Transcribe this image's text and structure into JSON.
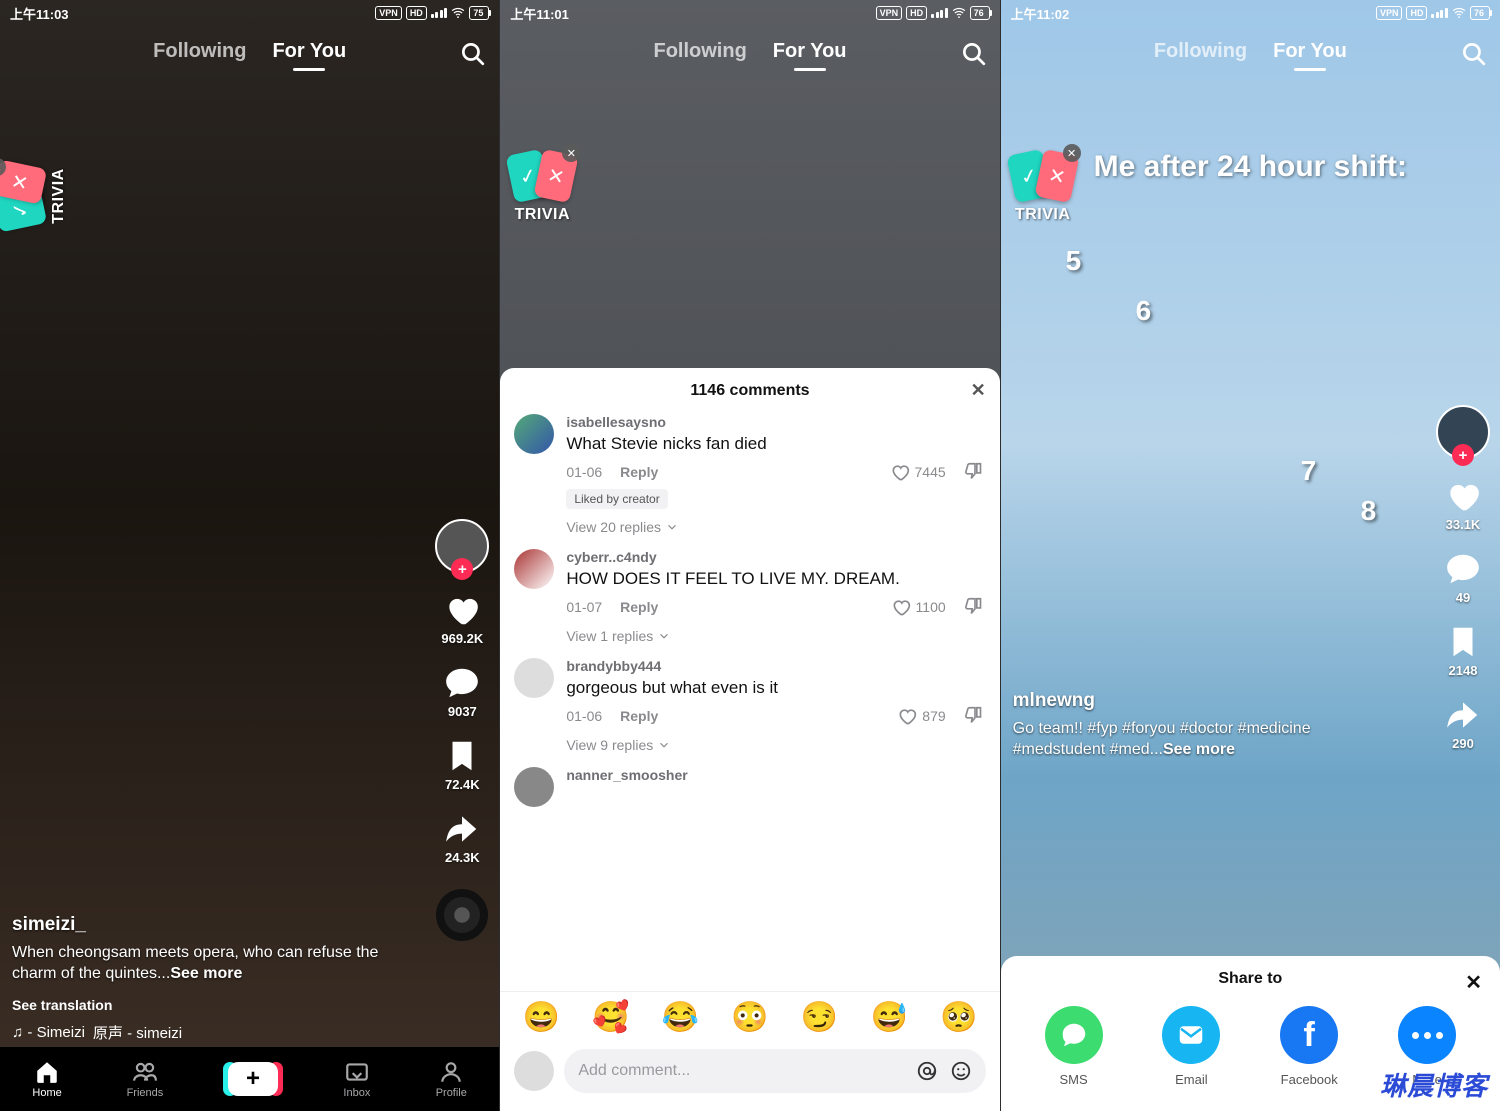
{
  "status": {
    "s1_time": "上午11:03",
    "s1_batt": "75",
    "s2_time": "上午11:01",
    "s2_batt": "76",
    "s3_time": "上午11:02",
    "s3_batt": "76",
    "vpn": "VPN",
    "hd": "HD"
  },
  "nav": {
    "following": "Following",
    "foryou": "For You"
  },
  "trivia": {
    "label": "TRIVIA"
  },
  "screen1": {
    "user": "simeizi_",
    "desc": "When cheongsam meets opera, who can refuse the charm of the quintes...",
    "seemore": "See more",
    "seetrans": "See translation",
    "soundA": "♫ - Simeizi",
    "soundB": "原声 - simeizi",
    "likes": "969.2K",
    "comments": "9037",
    "saves": "72.4K",
    "shares": "24.3K"
  },
  "bottomnav": {
    "home": "Home",
    "friends": "Friends",
    "inbox": "Inbox",
    "profile": "Profile"
  },
  "screen2": {
    "title": "1146 comments",
    "c1": {
      "user": "isabellesaysno",
      "text": "What Stevie nicks fan died",
      "date": "01-06",
      "reply": "Reply",
      "likes": "7445",
      "liked": "Liked by creator",
      "view": "View 20 replies"
    },
    "c2": {
      "user": "cyberr..c4ndy",
      "text": "HOW DOES IT FEEL TO LIVE MY. DREAM.",
      "date": "01-07",
      "reply": "Reply",
      "likes": "1100",
      "view": "View 1 replies"
    },
    "c3": {
      "user": "brandybby444",
      "text": "gorgeous but what even is it",
      "date": "01-06",
      "reply": "Reply",
      "likes": "879",
      "view": "View 9 replies"
    },
    "c4": {
      "user": "nanner_smoosher"
    },
    "emojis": {
      "e1": "😄",
      "e2": "🥰",
      "e3": "😂",
      "e4": "😳",
      "e5": "😏",
      "e6": "😅",
      "e7": "🥺"
    },
    "placeholder": "Add comment..."
  },
  "screen3": {
    "overlay": "Me after 24 hour shift:",
    "n5": "5",
    "n6": "6",
    "n7": "7",
    "n8": "8",
    "user": "mlnewng",
    "desc": "Go team!! #fyp #foryou #doctor #medicine #medstudent #med...",
    "seemore": "See more",
    "likes": "33.1K",
    "comments": "49",
    "saves": "2148",
    "shares": "290",
    "share": {
      "title": "Share to",
      "sms": "SMS",
      "email": "Email",
      "facebook": "Facebook",
      "more": "More"
    }
  },
  "watermark": "琳晨博客"
}
